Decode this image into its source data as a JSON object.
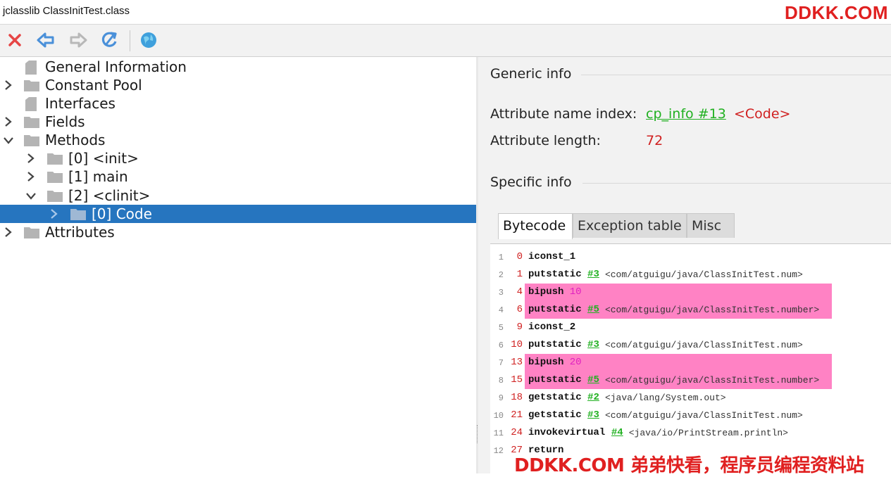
{
  "window": {
    "title": "jclasslib ClassInitTest.class"
  },
  "watermark": {
    "top": "DDKK.COM",
    "bottom": "DDKK.COM 弟弟快看，程序员编程资料站"
  },
  "toolbar": {
    "buttons": [
      {
        "icon": "close-icon",
        "color": "#e64545"
      },
      {
        "icon": "back-arrow-icon",
        "color": "#4a90d9"
      },
      {
        "icon": "forward-arrow-icon",
        "color": "#b8b8b8"
      },
      {
        "icon": "reload-icon",
        "color": "#4a90d9"
      },
      {
        "icon": "globe-icon",
        "color": "#3fa0dc"
      }
    ]
  },
  "tree": {
    "items": [
      {
        "label": "General Information"
      },
      {
        "label": "Constant Pool"
      },
      {
        "label": "Interfaces"
      },
      {
        "label": "Fields"
      },
      {
        "label": "Methods"
      },
      {
        "label": "[0] <init>"
      },
      {
        "label": "[1] main"
      },
      {
        "label": "[2] <clinit>"
      },
      {
        "label": "[0] Code"
      },
      {
        "label": "Attributes"
      }
    ],
    "selected_color": "#2675bf"
  },
  "generic": {
    "title": "Generic info",
    "name_index_label": "Attribute name index:",
    "name_index_link": "cp_info #13",
    "name_index_value": "<Code>",
    "length_label": "Attribute length:",
    "length_value": "72"
  },
  "specific": {
    "title": "Specific info"
  },
  "tabs": [
    {
      "label": "Bytecode"
    },
    {
      "label": "Exception table"
    },
    {
      "label": "Misc"
    }
  ],
  "bytecode": {
    "lines": [
      {
        "num": "1",
        "offset": "0",
        "op": "iconst_1",
        "ref": "",
        "arg": "",
        "sym": ""
      },
      {
        "num": "2",
        "offset": "1",
        "op": "putstatic",
        "ref": "#3",
        "arg": "",
        "sym": "<com/atguigu/java/ClassInitTest.num>"
      },
      {
        "num": "3",
        "offset": "4",
        "op": "bipush",
        "ref": "",
        "arg": "10",
        "sym": ""
      },
      {
        "num": "4",
        "offset": "6",
        "op": "putstatic",
        "ref": "#5",
        "arg": "",
        "sym": "<com/atguigu/java/ClassInitTest.number>"
      },
      {
        "num": "5",
        "offset": "9",
        "op": "iconst_2",
        "ref": "",
        "arg": "",
        "sym": ""
      },
      {
        "num": "6",
        "offset": "10",
        "op": "putstatic",
        "ref": "#3",
        "arg": "",
        "sym": "<com/atguigu/java/ClassInitTest.num>"
      },
      {
        "num": "7",
        "offset": "13",
        "op": "bipush",
        "ref": "",
        "arg": "20",
        "sym": ""
      },
      {
        "num": "8",
        "offset": "15",
        "op": "putstatic",
        "ref": "#5",
        "arg": "",
        "sym": "<com/atguigu/java/ClassInitTest.number>"
      },
      {
        "num": "9",
        "offset": "18",
        "op": "getstatic",
        "ref": "#2",
        "arg": "",
        "sym": "<java/lang/System.out>"
      },
      {
        "num": "10",
        "offset": "21",
        "op": "getstatic",
        "ref": "#3",
        "arg": "",
        "sym": "<com/atguigu/java/ClassInitTest.num>"
      },
      {
        "num": "11",
        "offset": "24",
        "op": "invokevirtual",
        "ref": "#4",
        "arg": "",
        "sym": "<java/io/PrintStream.println>"
      },
      {
        "num": "12",
        "offset": "27",
        "op": "return",
        "ref": "",
        "arg": "",
        "sym": ""
      }
    ],
    "highlight_color": "#ff82c4"
  }
}
